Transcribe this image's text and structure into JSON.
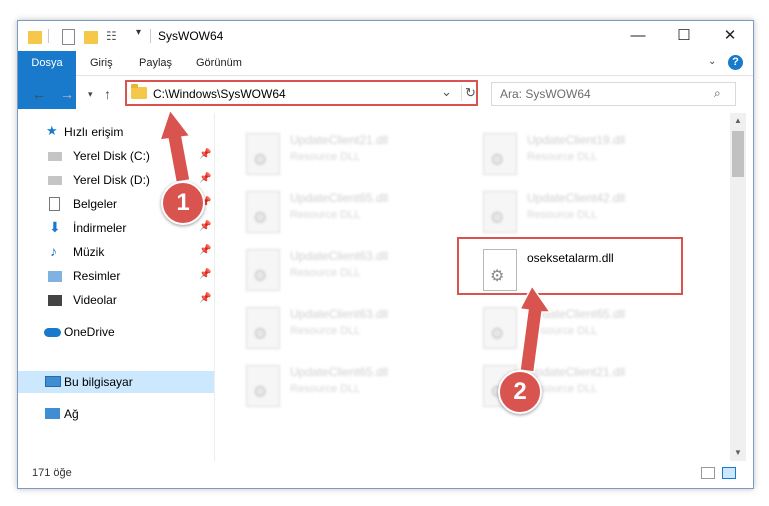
{
  "window": {
    "title": "SysWOW64",
    "minimize": "—",
    "maximize": "☐",
    "close": "✕"
  },
  "ribbon": {
    "tabs": [
      "Dosya",
      "Giriş",
      "Paylaş",
      "Görünüm"
    ],
    "help": "?"
  },
  "address": {
    "path": "C:\\Windows\\SysWOW64",
    "dropdown": "⌄",
    "refresh": "↻"
  },
  "search": {
    "placeholder": "Ara: SysWOW64",
    "icon": "search-icon"
  },
  "sidebar": {
    "items": [
      {
        "label": "Hızlı erişim",
        "icon": "star-icon"
      },
      {
        "label": "Yerel Disk (C:)",
        "icon": "drive-icon",
        "pinned": true
      },
      {
        "label": "Yerel Disk (D:)",
        "icon": "drive-icon",
        "pinned": true
      },
      {
        "label": "Belgeler",
        "icon": "document-icon",
        "pinned": true
      },
      {
        "label": "İndirmeler",
        "icon": "download-icon",
        "pinned": true
      },
      {
        "label": "Müzik",
        "icon": "music-icon",
        "pinned": true
      },
      {
        "label": "Resimler",
        "icon": "pictures-icon",
        "pinned": true
      },
      {
        "label": "Videolar",
        "icon": "videos-icon",
        "pinned": true
      },
      {
        "label": "OneDrive",
        "icon": "cloud-icon"
      },
      {
        "label": "Bu bilgisayar",
        "icon": "computer-icon",
        "selected": true
      },
      {
        "label": "Ağ",
        "icon": "network-icon"
      }
    ]
  },
  "files": [
    {
      "name": "UpdateClient21.dll",
      "type": "Resource DLL"
    },
    {
      "name": "UpdateClient19.dll",
      "type": "Resource DLL"
    },
    {
      "name": "UpdateClient65.dll",
      "type": "Resource DLL"
    },
    {
      "name": "UpdateClient42.dll",
      "type": "Resource DLL"
    },
    {
      "name": "UpdateClient63.dll",
      "type": "Resource DLL"
    },
    {
      "name": "oseksetalarm.dll",
      "type": ""
    },
    {
      "name": "UpdateClient63.dll",
      "type": "Resource DLL"
    },
    {
      "name": "UpdateClient65.dll",
      "type": "Resource DLL"
    },
    {
      "name": "UpdateClient65.dll",
      "type": "Resource DLL"
    },
    {
      "name": "UpdateClient21.dll",
      "type": "Resource DLL"
    }
  ],
  "status": {
    "count": "171 öğe"
  },
  "annotations": {
    "step1": "1",
    "step2": "2",
    "color": "#d9534f"
  }
}
